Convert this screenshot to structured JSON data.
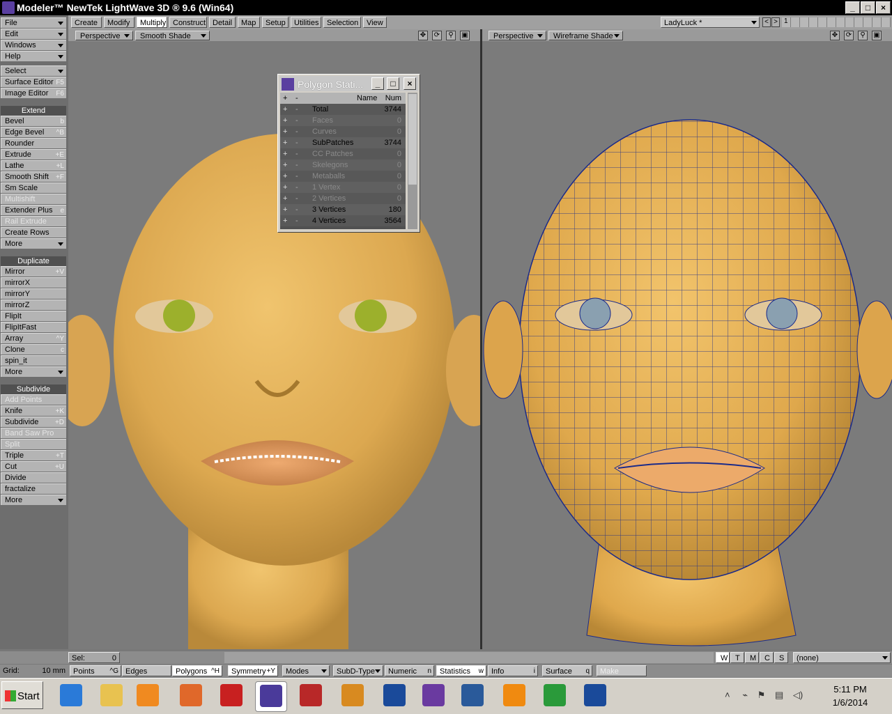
{
  "title": "Modeler™ NewTek LightWave 3D ® 9.6  (Win64)",
  "window_buttons": [
    "_",
    "□",
    "×"
  ],
  "menu": [
    {
      "label": "File"
    },
    {
      "label": "Edit"
    },
    {
      "label": "Windows"
    },
    {
      "label": "Help"
    }
  ],
  "tabs": [
    "Create",
    "Modify",
    "Multiply",
    "Construct",
    "Detail",
    "Map",
    "Setup",
    "Utilities",
    "Selection",
    "View"
  ],
  "active_tab": "Multiply",
  "object_name": "LadyLuck *",
  "layer_number": "1",
  "left_panel": {
    "select": "Select",
    "surface_editor": {
      "label": "Surface Editor",
      "shortcut": "F5"
    },
    "image_editor": {
      "label": "Image Editor",
      "shortcut": "F6"
    },
    "extend_header": "Extend",
    "extend": [
      {
        "label": "Bevel",
        "shortcut": "b"
      },
      {
        "label": "Edge Bevel",
        "shortcut": "^B"
      },
      {
        "label": "Rounder",
        "shortcut": ""
      },
      {
        "label": "Extrude",
        "shortcut": "+E"
      },
      {
        "label": "Lathe",
        "shortcut": "+L"
      },
      {
        "label": "Smooth Shift",
        "shortcut": "+F"
      },
      {
        "label": "Sm Scale",
        "shortcut": ""
      },
      {
        "label": "Multishift",
        "shortcut": ""
      },
      {
        "label": "Extender Plus",
        "shortcut": "e"
      },
      {
        "label": "Rail Extrude",
        "shortcut": ""
      },
      {
        "label": "Create Rows",
        "shortcut": ""
      },
      {
        "label": "More",
        "shortcut": ""
      }
    ],
    "duplicate_header": "Duplicate",
    "duplicate": [
      {
        "label": "Mirror",
        "shortcut": "+V"
      },
      {
        "label": "mirrorX",
        "shortcut": ""
      },
      {
        "label": "mirrorY",
        "shortcut": ""
      },
      {
        "label": "mirrorZ",
        "shortcut": ""
      },
      {
        "label": "FlipIt",
        "shortcut": ""
      },
      {
        "label": "FlipItFast",
        "shortcut": ""
      },
      {
        "label": "Array",
        "shortcut": "^Y"
      },
      {
        "label": "Clone",
        "shortcut": "c"
      },
      {
        "label": "spin_it",
        "shortcut": ""
      },
      {
        "label": "More",
        "shortcut": ""
      }
    ],
    "subdivide_header": "Subdivide",
    "subdivide": [
      {
        "label": "Add Points",
        "shortcut": ""
      },
      {
        "label": "Knife",
        "shortcut": "+K"
      },
      {
        "label": "Subdivide",
        "shortcut": "+D"
      },
      {
        "label": "Band Saw Pro",
        "shortcut": ""
      },
      {
        "label": "Split",
        "shortcut": ""
      },
      {
        "label": "Triple",
        "shortcut": "+T"
      },
      {
        "label": "Cut",
        "shortcut": "+U"
      },
      {
        "label": "Divide",
        "shortcut": ""
      },
      {
        "label": "fractalize",
        "shortcut": ""
      },
      {
        "label": "More",
        "shortcut": ""
      }
    ]
  },
  "viewport_left": {
    "view": "Perspective",
    "shade": "Smooth Shade"
  },
  "viewport_right": {
    "view": "Perspective",
    "shade": "Wireframe Shade"
  },
  "stats_window": {
    "title": "Polygon Stati...",
    "header": {
      "plus": "+",
      "minus": "-",
      "name": "Name",
      "num": "Num"
    },
    "rows": [
      {
        "name": "Total",
        "num": "3744"
      },
      {
        "name": "Faces",
        "num": "0"
      },
      {
        "name": "Curves",
        "num": "0"
      },
      {
        "name": "SubPatches",
        "num": "3744"
      },
      {
        "name": "CC Patches",
        "num": "0"
      },
      {
        "name": "Skelegons",
        "num": "0"
      },
      {
        "name": "Metaballs",
        "num": "0"
      },
      {
        "name": "1 Vertex",
        "num": "0"
      },
      {
        "name": "2 Vertices",
        "num": "0"
      },
      {
        "name": "3 Vertices",
        "num": "180"
      },
      {
        "name": "4 Vertices",
        "num": "3564"
      }
    ]
  },
  "bottom": {
    "sel_label": "Sel:",
    "sel_value": "0",
    "wtmcs": [
      "W",
      "T",
      "M",
      "C",
      "S"
    ],
    "surface_select": "(none)",
    "grid_label": "Grid:",
    "grid_value": "10 mm",
    "buttons": [
      {
        "label": "Points",
        "shortcut": "^G"
      },
      {
        "label": "Edges",
        "shortcut": ""
      },
      {
        "label": "Polygons",
        "shortcut": "^H"
      },
      {
        "label": "Symmetry",
        "shortcut": "+Y"
      },
      {
        "label": "Modes",
        "shortcut": ""
      },
      {
        "label": "SubD-Type",
        "shortcut": ""
      },
      {
        "label": "Numeric",
        "shortcut": "n"
      },
      {
        "label": "Statistics",
        "shortcut": "w"
      },
      {
        "label": "Info",
        "shortcut": "i"
      },
      {
        "label": "Surface",
        "shortcut": "q"
      },
      {
        "label": "Make",
        "shortcut": ""
      }
    ]
  },
  "taskbar": {
    "start": "Start",
    "time": "5:11 PM",
    "date": "1/6/2014"
  },
  "colors": {
    "skin": "#e2b25a",
    "wire": "#1a2a8a",
    "bg": "#7b7b7b"
  }
}
